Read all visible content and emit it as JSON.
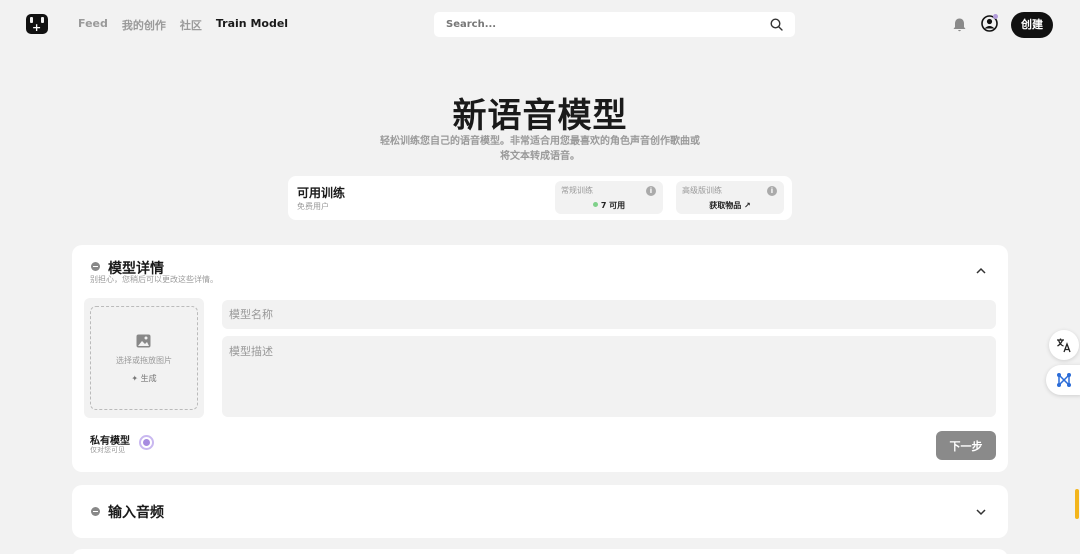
{
  "header": {
    "nav": [
      "Feed",
      "我的创作",
      "社区",
      "Train Model"
    ],
    "nav_active_index": 3,
    "search": {
      "placeholder": "Search..."
    },
    "create_label": "创建"
  },
  "hero": {
    "title": "新语音模型",
    "subtitle_line1": "轻松训练您自己的语音模型。非常适合用您最喜欢的角色声音创作歌曲或",
    "subtitle_line2": "将文本转成语音。"
  },
  "quota": {
    "title": "可用训练",
    "subtitle": "免费用户",
    "regular": {
      "label": "常规训练",
      "value": "7 可用",
      "status_color": "#7fd18a"
    },
    "advanced": {
      "label": "高级版训练",
      "value": "获取物品 ↗"
    }
  },
  "details": {
    "title": "模型详情",
    "description": "别担心，您稍后可以更改这些详情。",
    "upload_text": "选择或拖放图片",
    "generate_label": "✦ 生成",
    "name_placeholder": "模型名称",
    "desc_placeholder": "模型描述",
    "private_label": "私有模型",
    "private_sub": "仅对您可见",
    "next_label": "下一步"
  },
  "audio": {
    "title": "输入音频"
  },
  "colors": {
    "accent": "#111111",
    "radio": "#a78be0",
    "scroll": "#f3b51c"
  }
}
